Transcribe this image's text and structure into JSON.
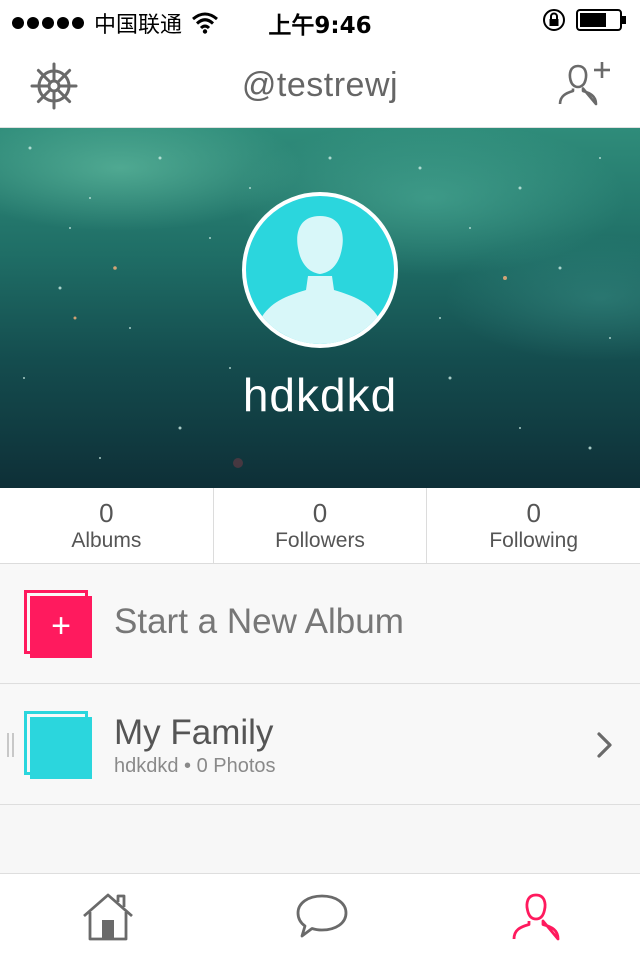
{
  "status_bar": {
    "carrier": "中国联通",
    "time": "上午9:46"
  },
  "nav": {
    "title": "@testrewj"
  },
  "profile": {
    "name": "hdkdkd"
  },
  "stats": [
    {
      "count": "0",
      "label": "Albums"
    },
    {
      "count": "0",
      "label": "Followers"
    },
    {
      "count": "0",
      "label": "Following"
    }
  ],
  "new_album": {
    "plus": "+",
    "label": "Start a New Album"
  },
  "albums": [
    {
      "title": "My Family",
      "subtitle": "hdkdkd • 0 Photos"
    }
  ],
  "icons": {
    "settings": "gear-icon",
    "add_friend": "add-user-icon",
    "home": "home-icon",
    "messages": "speech-bubble-icon",
    "profile": "user-icon"
  },
  "colors": {
    "accent_pink": "#ff1a5e",
    "accent_cyan": "#2bd6dd",
    "icon_gray": "#6a6a6a"
  }
}
